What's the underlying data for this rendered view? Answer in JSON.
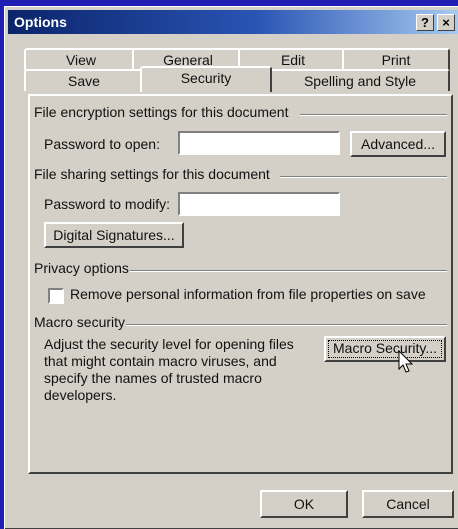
{
  "window": {
    "title": "Options",
    "help_button": "?",
    "close_button": "×"
  },
  "tabs": {
    "row_back": [
      "View",
      "General",
      "Edit",
      "Print"
    ],
    "row_front": [
      "Save",
      "Security",
      "Spelling and Style"
    ],
    "active": "Security"
  },
  "encryption": {
    "group_title": "File encryption settings for this document",
    "password_label": "Password to open:",
    "password_value": "",
    "advanced_button": "Advanced..."
  },
  "sharing": {
    "group_title": "File sharing settings for this document",
    "password_label": "Password to modify:",
    "password_value": "",
    "signatures_button": "Digital Signatures..."
  },
  "privacy": {
    "group_title": "Privacy options",
    "remove_info_label": "Remove personal information from file properties on save",
    "remove_info_checked": false
  },
  "macro": {
    "group_title": "Macro security",
    "description_lines": [
      "Adjust the security level for opening files",
      "that might contain macro viruses, and",
      "specify the names of trusted macro",
      "developers."
    ],
    "button": "Macro Security..."
  },
  "footer": {
    "ok_button": "OK",
    "cancel_button": "Cancel"
  }
}
